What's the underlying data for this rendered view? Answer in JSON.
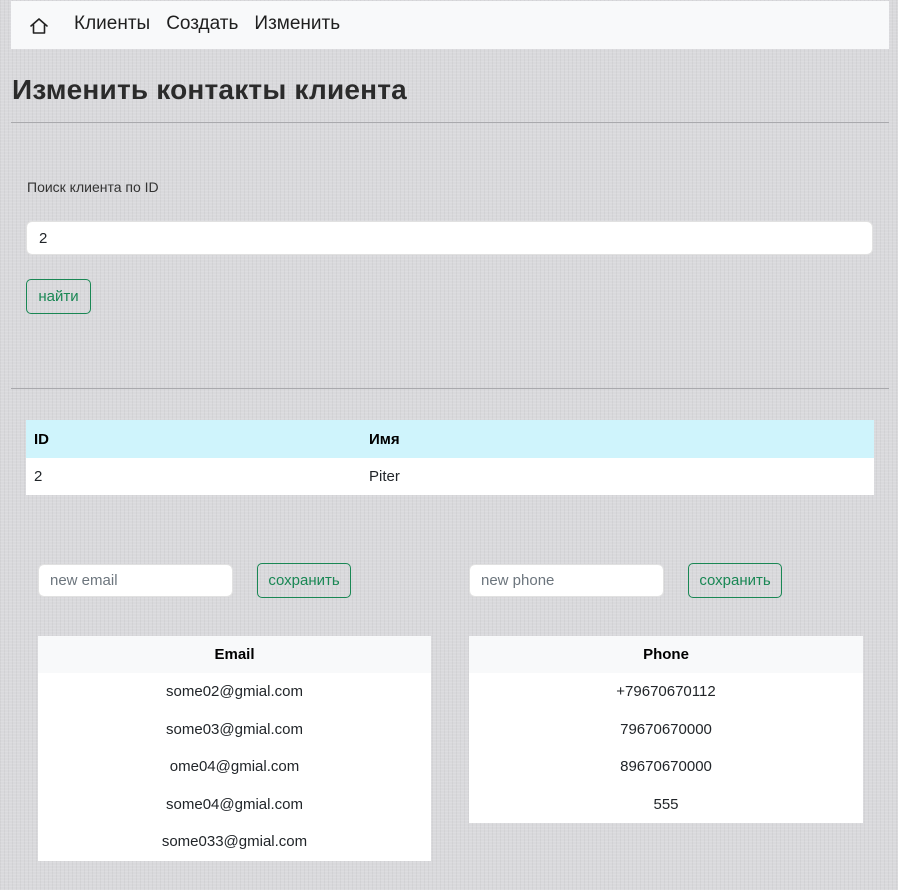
{
  "navbar": {
    "home_icon": "home-icon",
    "links": [
      "Клиенты",
      "Создать",
      "Изменить"
    ]
  },
  "page": {
    "title": "Изменить контакты клиента"
  },
  "search": {
    "label": "Поиск клиента по ID",
    "value": "2",
    "button_label": "найти"
  },
  "client_table": {
    "headers": [
      "ID",
      "Имя"
    ],
    "rows": [
      [
        "2",
        "Piter"
      ]
    ]
  },
  "email_form": {
    "placeholder": "new email",
    "value": "",
    "button_label": "сохранить"
  },
  "phone_form": {
    "placeholder": "new phone",
    "value": "",
    "button_label": "сохранить"
  },
  "email_table": {
    "header": "Email",
    "rows": [
      "some02@gmial.com",
      "some03@gmial.com",
      "ome04@gmial.com",
      "some04@gmial.com",
      "some033@gmial.com"
    ]
  },
  "phone_table": {
    "header": "Phone",
    "rows": [
      "+79670670112",
      "79670670000",
      "89670670000",
      "555"
    ]
  },
  "colors": {
    "accent_green": "#198754",
    "table_header_info": "#cff4fc",
    "navbar_bg": "#f8f9fa"
  }
}
